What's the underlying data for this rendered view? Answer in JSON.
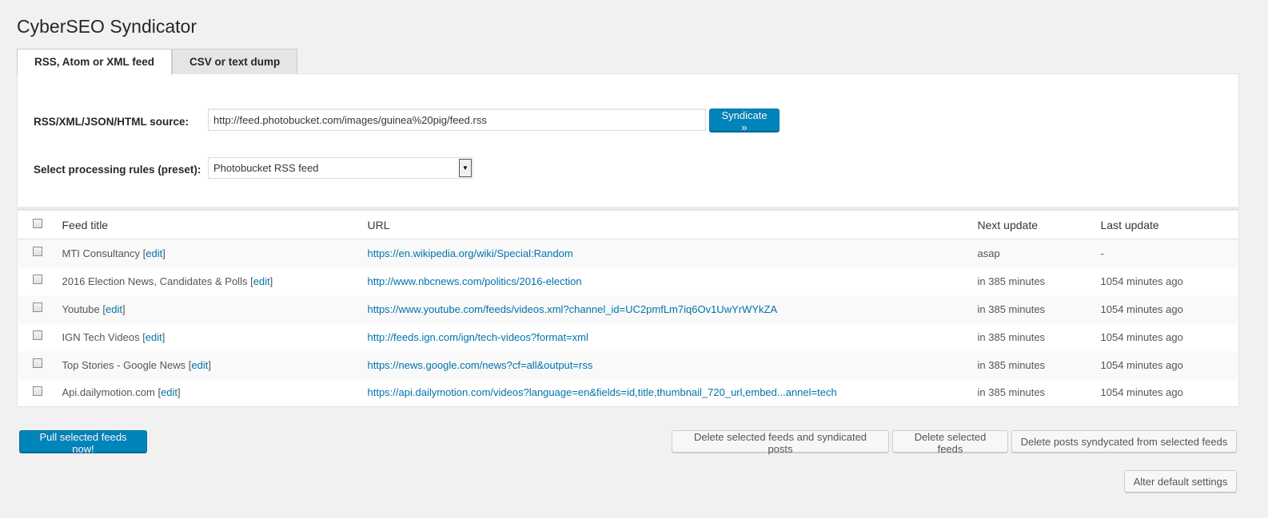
{
  "page": {
    "title": "CyberSEO Syndicator"
  },
  "tabs": [
    {
      "label": "RSS, Atom or XML feed",
      "active": true
    },
    {
      "label": "CSV or text dump",
      "active": false
    }
  ],
  "form": {
    "source_label": "RSS/XML/JSON/HTML source:",
    "source_value": "http://feed.photobucket.com/images/guinea%20pig/feed.rss",
    "syndicate_label": "Syndicate »",
    "preset_label": "Select processing rules (preset):",
    "preset_value": "Photobucket RSS feed"
  },
  "table": {
    "headers": {
      "title": "Feed title",
      "url": "URL",
      "next": "Next update",
      "last": "Last update"
    },
    "edit_label": "edit",
    "rows": [
      {
        "title": "MTI Consultancy",
        "url": "https://en.wikipedia.org/wiki/Special:Random",
        "next": "asap",
        "last": "-"
      },
      {
        "title": "2016 Election News, Candidates & Polls",
        "url": "http://www.nbcnews.com/politics/2016-election",
        "next": "in 385 minutes",
        "last": "1054 minutes ago"
      },
      {
        "title": "Youtube",
        "url": "https://www.youtube.com/feeds/videos.xml?channel_id=UC2pmfLm7iq6Ov1UwYrWYkZA",
        "next": "in 385 minutes",
        "last": "1054 minutes ago"
      },
      {
        "title": "IGN Tech Videos",
        "url": "http://feeds.ign.com/ign/tech-videos?format=xml",
        "next": "in 385 minutes",
        "last": "1054 minutes ago"
      },
      {
        "title": "Top Stories - Google News",
        "url": "https://news.google.com/news?cf=all&output=rss",
        "next": "in 385 minutes",
        "last": "1054 minutes ago"
      },
      {
        "title": "Api.dailymotion.com",
        "url": "https://api.dailymotion.com/videos?language=en&fields=id,title,thumbnail_720_url,embed...annel=tech",
        "next": "in 385 minutes",
        "last": "1054 minutes ago"
      }
    ]
  },
  "actions": {
    "pull": "Pull selected feeds now!",
    "delete_feeds_posts": "Delete selected feeds and syndicated posts",
    "delete_feeds": "Delete selected feeds",
    "delete_posts": "Delete posts syndycated from selected feeds",
    "alter_defaults": "Alter default settings"
  },
  "colors": {
    "primary": "#0085ba",
    "link": "#0073aa",
    "background": "#f1f1f1"
  }
}
